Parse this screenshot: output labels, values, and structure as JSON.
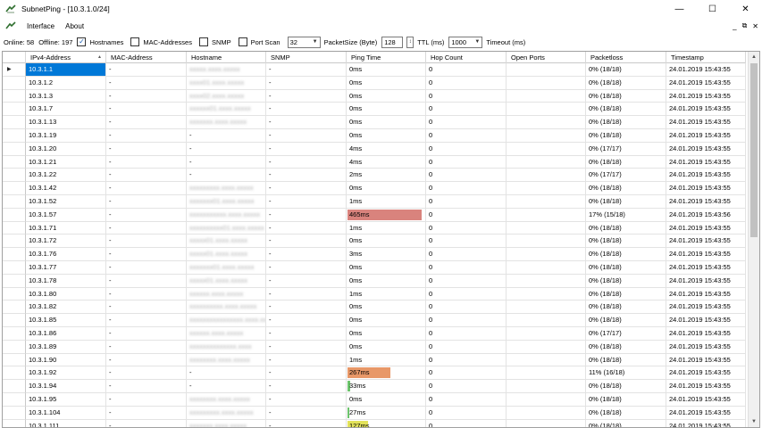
{
  "window": {
    "title": "SubnetPing - [10.3.1.0/24]",
    "minimize": "—",
    "maximize": "☐",
    "close": "✕"
  },
  "menu": {
    "items": [
      "Interface",
      "About"
    ],
    "mdi_minimize": "_",
    "mdi_restore": "⧉",
    "mdi_close": "✕"
  },
  "toolbar": {
    "online": "Online: 58",
    "offline": "Offline: 197",
    "hostnames_label": "Hostnames",
    "hostnames_checked": true,
    "mac_label": "MAC-Addresses",
    "mac_checked": false,
    "snmp_label": "SNMP",
    "snmp_checked": false,
    "portscan_label": "Port Scan",
    "portscan_checked": false,
    "packetsize_value": "32",
    "packetsize_label": "PacketSize (Byte)",
    "ttl_value": "128",
    "ttl_label": "TTL (ms)",
    "timeout_value": "1000",
    "timeout_label": "Timeout (ms)"
  },
  "grid": {
    "columns": [
      "IPv4-Address",
      "MAC-Address",
      "Hostname",
      "SNMP",
      "Ping Time",
      "Hop Count",
      "Open Ports",
      "Packetloss",
      "Timestamp"
    ],
    "sort_indicator": "▲",
    "row_pointer": "▶",
    "rows": [
      {
        "ip": "10.3.1.1",
        "mac": "-",
        "host": "xxxxx.xxxx.xxxxx",
        "snmp": "-",
        "ping": "0ms",
        "hop": "0",
        "ports": "",
        "loss": "0% (18/18)",
        "ts": "24.01.2019 15:43:55",
        "ping_color": "",
        "ping_pct": 0
      },
      {
        "ip": "10.3.1.2",
        "mac": "-",
        "host": "xxxx01.xxxx.xxxxx",
        "snmp": "-",
        "ping": "0ms",
        "hop": "0",
        "ports": "",
        "loss": "0% (18/18)",
        "ts": "24.01.2019 15:43:55",
        "ping_color": "",
        "ping_pct": 0
      },
      {
        "ip": "10.3.1.3",
        "mac": "-",
        "host": "xxxx02.xxxx.xxxxx",
        "snmp": "-",
        "ping": "0ms",
        "hop": "0",
        "ports": "",
        "loss": "0% (18/18)",
        "ts": "24.01.2019 15:43:55",
        "ping_color": "",
        "ping_pct": 0
      },
      {
        "ip": "10.3.1.7",
        "mac": "-",
        "host": "xxxxxx01.xxxx.xxxxx",
        "snmp": "-",
        "ping": "0ms",
        "hop": "0",
        "ports": "",
        "loss": "0% (18/18)",
        "ts": "24.01.2019 15:43:55",
        "ping_color": "",
        "ping_pct": 0
      },
      {
        "ip": "10.3.1.13",
        "mac": "-",
        "host": "xxxxxxx.xxxx.xxxxx",
        "snmp": "-",
        "ping": "0ms",
        "hop": "0",
        "ports": "",
        "loss": "0% (18/18)",
        "ts": "24.01.2019 15:43:55",
        "ping_color": "",
        "ping_pct": 0
      },
      {
        "ip": "10.3.1.19",
        "mac": "-",
        "host": "-",
        "snmp": "-",
        "ping": "0ms",
        "hop": "0",
        "ports": "",
        "loss": "0% (18/18)",
        "ts": "24.01.2019 15:43:55",
        "ping_color": "",
        "ping_pct": 0
      },
      {
        "ip": "10.3.1.20",
        "mac": "-",
        "host": "-",
        "snmp": "-",
        "ping": "4ms",
        "hop": "0",
        "ports": "",
        "loss": "0% (17/17)",
        "ts": "24.01.2019 15:43:55",
        "ping_color": "",
        "ping_pct": 0
      },
      {
        "ip": "10.3.1.21",
        "mac": "-",
        "host": "-",
        "snmp": "-",
        "ping": "4ms",
        "hop": "0",
        "ports": "",
        "loss": "0% (18/18)",
        "ts": "24.01.2019 15:43:55",
        "ping_color": "",
        "ping_pct": 0
      },
      {
        "ip": "10.3.1.22",
        "mac": "-",
        "host": "-",
        "snmp": "-",
        "ping": "2ms",
        "hop": "0",
        "ports": "",
        "loss": "0% (17/17)",
        "ts": "24.01.2019 15:43:55",
        "ping_color": "",
        "ping_pct": 0
      },
      {
        "ip": "10.3.1.42",
        "mac": "-",
        "host": "xxxxxxxxx.xxxx.xxxxx",
        "snmp": "-",
        "ping": "0ms",
        "hop": "0",
        "ports": "",
        "loss": "0% (18/18)",
        "ts": "24.01.2019 15:43:55",
        "ping_color": "",
        "ping_pct": 0
      },
      {
        "ip": "10.3.1.52",
        "mac": "-",
        "host": "xxxxxxx01.xxxx.xxxxx",
        "snmp": "-",
        "ping": "1ms",
        "hop": "0",
        "ports": "",
        "loss": "0% (18/18)",
        "ts": "24.01.2019 15:43:55",
        "ping_color": "",
        "ping_pct": 0
      },
      {
        "ip": "10.3.1.57",
        "mac": "-",
        "host": "xxxxxxxxxxx.xxxx.xxxxx",
        "snmp": "-",
        "ping": "465ms",
        "hop": "0",
        "ports": "",
        "loss": "17% (15/18)",
        "ts": "24.01.2019 15:43:56",
        "ping_color": "#d9837d",
        "ping_pct": 97
      },
      {
        "ip": "10.3.1.71",
        "mac": "-",
        "host": "xxxxxxxxxx01.xxxx.xxxxx",
        "snmp": "-",
        "ping": "1ms",
        "hop": "0",
        "ports": "",
        "loss": "0% (18/18)",
        "ts": "24.01.2019 15:43:55",
        "ping_color": "",
        "ping_pct": 0
      },
      {
        "ip": "10.3.1.72",
        "mac": "-",
        "host": "xxxxx01.xxxx.xxxxx",
        "snmp": "-",
        "ping": "0ms",
        "hop": "0",
        "ports": "",
        "loss": "0% (18/18)",
        "ts": "24.01.2019 15:43:55",
        "ping_color": "",
        "ping_pct": 0
      },
      {
        "ip": "10.3.1.76",
        "mac": "-",
        "host": "xxxxx01.xxxx.xxxxx",
        "snmp": "-",
        "ping": "3ms",
        "hop": "0",
        "ports": "",
        "loss": "0% (18/18)",
        "ts": "24.01.2019 15:43:55",
        "ping_color": "",
        "ping_pct": 0
      },
      {
        "ip": "10.3.1.77",
        "mac": "-",
        "host": "xxxxxxx01.xxxx.xxxxx",
        "snmp": "-",
        "ping": "0ms",
        "hop": "0",
        "ports": "",
        "loss": "0% (18/18)",
        "ts": "24.01.2019 15:43:55",
        "ping_color": "",
        "ping_pct": 0
      },
      {
        "ip": "10.3.1.78",
        "mac": "-",
        "host": "xxxxx01.xxxx.xxxxx",
        "snmp": "-",
        "ping": "0ms",
        "hop": "0",
        "ports": "",
        "loss": "0% (18/18)",
        "ts": "24.01.2019 15:43:55",
        "ping_color": "",
        "ping_pct": 0
      },
      {
        "ip": "10.3.1.80",
        "mac": "-",
        "host": "xxxxxx.xxxx.xxxxx",
        "snmp": "-",
        "ping": "1ms",
        "hop": "0",
        "ports": "",
        "loss": "0% (18/18)",
        "ts": "24.01.2019 15:43:55",
        "ping_color": "",
        "ping_pct": 0
      },
      {
        "ip": "10.3.1.82",
        "mac": "-",
        "host": "xxxxxxxxxx.xxxx.xxxxx",
        "snmp": "-",
        "ping": "0ms",
        "hop": "0",
        "ports": "",
        "loss": "0% (18/18)",
        "ts": "24.01.2019 15:43:55",
        "ping_color": "",
        "ping_pct": 0
      },
      {
        "ip": "10.3.1.85",
        "mac": "-",
        "host": "xxxxxxxxxxxxxxxx.xxxx.xxxxx",
        "snmp": "-",
        "ping": "0ms",
        "hop": "0",
        "ports": "",
        "loss": "0% (18/18)",
        "ts": "24.01.2019 15:43:55",
        "ping_color": "",
        "ping_pct": 0
      },
      {
        "ip": "10.3.1.86",
        "mac": "-",
        "host": "xxxxxx.xxxx.xxxxx",
        "snmp": "-",
        "ping": "0ms",
        "hop": "0",
        "ports": "",
        "loss": "0% (17/17)",
        "ts": "24.01.2019 15:43:55",
        "ping_color": "",
        "ping_pct": 0
      },
      {
        "ip": "10.3.1.89",
        "mac": "-",
        "host": "xxxxxxxxxxxxxx.xxxx",
        "snmp": "-",
        "ping": "0ms",
        "hop": "0",
        "ports": "",
        "loss": "0% (18/18)",
        "ts": "24.01.2019 15:43:55",
        "ping_color": "",
        "ping_pct": 0
      },
      {
        "ip": "10.3.1.90",
        "mac": "-",
        "host": "xxxxxxxx.xxxx.xxxxx",
        "snmp": "-",
        "ping": "1ms",
        "hop": "0",
        "ports": "",
        "loss": "0% (18/18)",
        "ts": "24.01.2019 15:43:55",
        "ping_color": "",
        "ping_pct": 0
      },
      {
        "ip": "10.3.1.92",
        "mac": "-",
        "host": "-",
        "snmp": "-",
        "ping": "267ms",
        "hop": "0",
        "ports": "",
        "loss": "11% (16/18)",
        "ts": "24.01.2019 15:43:55",
        "ping_color": "#e89868",
        "ping_pct": 56
      },
      {
        "ip": "10.3.1.94",
        "mac": "-",
        "host": "-",
        "snmp": "-",
        "ping": "33ms",
        "hop": "0",
        "ports": "",
        "loss": "0% (18/18)",
        "ts": "24.01.2019 15:43:55",
        "ping_color": "#6cc46c",
        "ping_pct": 3
      },
      {
        "ip": "10.3.1.95",
        "mac": "-",
        "host": "xxxxxxxx.xxxx.xxxxx",
        "snmp": "-",
        "ping": "0ms",
        "hop": "0",
        "ports": "",
        "loss": "0% (18/18)",
        "ts": "24.01.2019 15:43:55",
        "ping_color": "",
        "ping_pct": 0
      },
      {
        "ip": "10.3.1.104",
        "mac": "-",
        "host": "xxxxxxxxx.xxxx.xxxxx",
        "snmp": "-",
        "ping": "27ms",
        "hop": "0",
        "ports": "",
        "loss": "0% (18/18)",
        "ts": "24.01.2019 15:43:55",
        "ping_color": "#6cc46c",
        "ping_pct": 2
      },
      {
        "ip": "10.3.1.111",
        "mac": "-",
        "host": "xxxxxxx.xxxx.xxxxx",
        "snmp": "-",
        "ping": "127ms",
        "hop": "0",
        "ports": "",
        "loss": "0% (18/18)",
        "ts": "24.01.2019 15:43:55",
        "ping_color": "#e3e35a",
        "ping_pct": 27
      }
    ]
  }
}
